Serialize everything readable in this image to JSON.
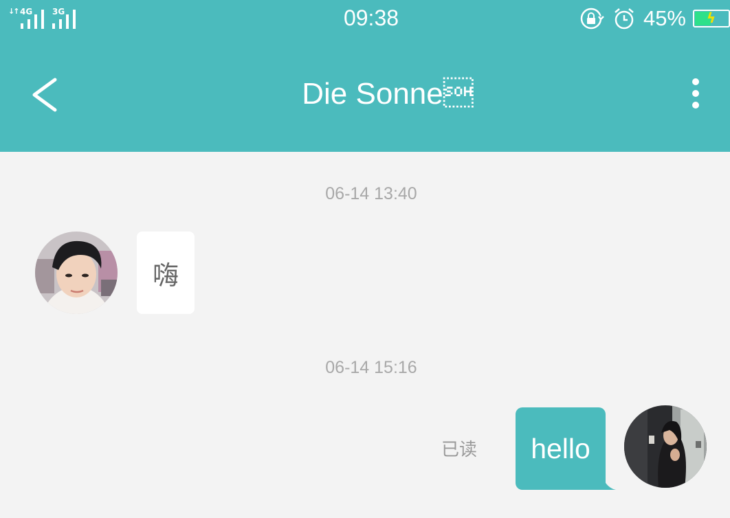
{
  "status_bar": {
    "network1": "4G",
    "network2": "3G",
    "time": "09:38",
    "battery_percent": "45%",
    "battery_level": 0.45,
    "battery_fill_color": "#2ee08a"
  },
  "header": {
    "title": "Die Sonne\u0001",
    "back_icon": "chevron-left-icon",
    "more_icon": "more-vertical-icon",
    "background": "#4bbbbd"
  },
  "messages": [
    {
      "timestamp": "06-14 13:40",
      "direction": "incoming",
      "text": "嗨"
    },
    {
      "timestamp": "06-14 15:16",
      "direction": "outgoing",
      "text": "hello",
      "status": "已读"
    }
  ],
  "colors": {
    "accent": "#4bbbbd",
    "background": "#f3f3f3",
    "incoming_bubble": "#ffffff"
  }
}
